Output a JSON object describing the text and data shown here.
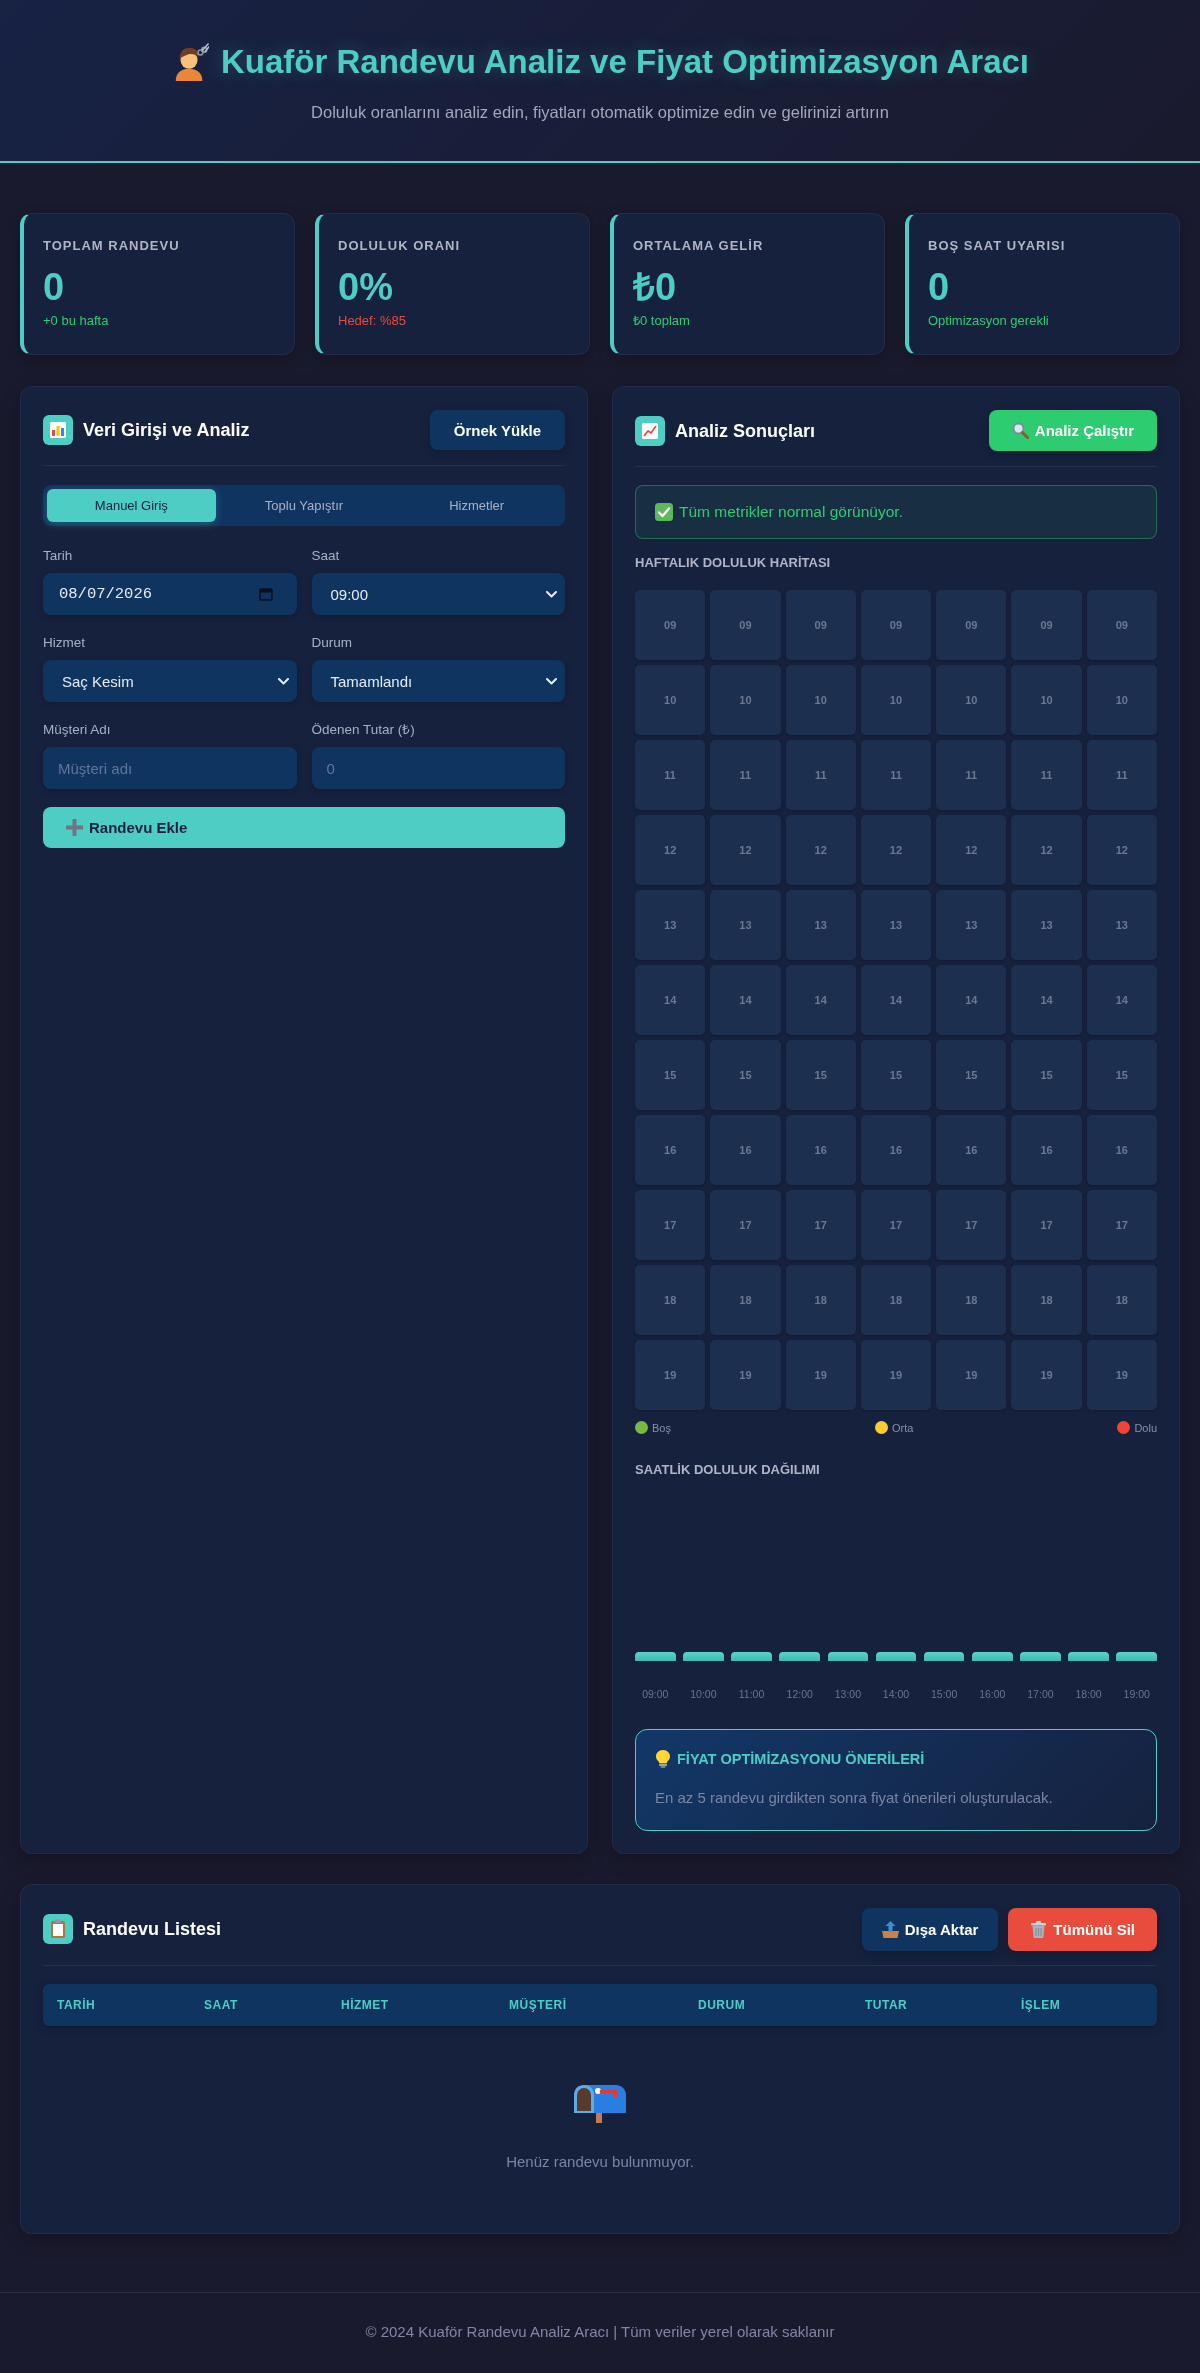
{
  "header": {
    "title": "Kuaför Randevu Analiz ve Fiyat Optimizasyon Aracı",
    "subtitle": "Doluluk oranlarını analiz edin, fiyatları otomatik optimize edin ve gelirinizi artırın"
  },
  "stats": [
    {
      "label": "TOPLAM RANDEVU",
      "value": "0",
      "note": "+0 bu hafta",
      "kind": "positive"
    },
    {
      "label": "DOLULUK ORANI",
      "value": "0%",
      "note": "Hedef: %85",
      "kind": "negative"
    },
    {
      "label": "ORTALAMA GELİR",
      "value": "₺0",
      "note": "₺0 toplam",
      "kind": "positive"
    },
    {
      "label": "BOŞ SAAT UYARISI",
      "value": "0",
      "note": "Optimizasyon gerekli",
      "kind": "positive"
    }
  ],
  "entry_panel": {
    "title": "Veri Girişi ve Analiz",
    "sample_button": "Örnek Yükle",
    "tabs": [
      {
        "label": "Manuel Giriş",
        "selected": true
      },
      {
        "label": "Toplu Yapıştır",
        "selected": false
      },
      {
        "label": "Hizmetler",
        "selected": false
      }
    ],
    "fields": [
      {
        "label": "Tarih",
        "kind": "date",
        "value": "08/07/2026"
      },
      {
        "label": "Saat",
        "kind": "select",
        "value": "09:00"
      },
      {
        "label": "Hizmet",
        "kind": "select",
        "value": "Saç Kesim"
      },
      {
        "label": "Durum",
        "kind": "select",
        "value": "Tamamlandı"
      },
      {
        "label": "Müşteri Adı",
        "kind": "text",
        "placeholder": "Müşteri adı"
      },
      {
        "label": "Ödenen Tutar (₺)",
        "kind": "number",
        "placeholder": "0"
      }
    ],
    "add_button": "Randevu Ekle"
  },
  "analysis_panel": {
    "title": "Analiz Sonuçları",
    "run_button": "Analiz Çalıştır",
    "alert": {
      "kind": "success",
      "text": "Tüm metrikler normal görünüyor."
    },
    "heatmap": {
      "title": "HAFTALIK DOLULUK HARİTASI",
      "rows": [
        [
          "09",
          "09",
          "09",
          "09",
          "09",
          "09",
          "09"
        ],
        [
          "10",
          "10",
          "10",
          "10",
          "10",
          "10",
          "10"
        ],
        [
          "11",
          "11",
          "11",
          "11",
          "11",
          "11",
          "11"
        ],
        [
          "12",
          "12",
          "12",
          "12",
          "12",
          "12",
          "12"
        ],
        [
          "13",
          "13",
          "13",
          "13",
          "13",
          "13",
          "13"
        ],
        [
          "14",
          "14",
          "14",
          "14",
          "14",
          "14",
          "14"
        ],
        [
          "15",
          "15",
          "15",
          "15",
          "15",
          "15",
          "15"
        ],
        [
          "16",
          "16",
          "16",
          "16",
          "16",
          "16",
          "16"
        ],
        [
          "17",
          "17",
          "17",
          "17",
          "17",
          "17",
          "17"
        ],
        [
          "18",
          "18",
          "18",
          "18",
          "18",
          "18",
          "18"
        ],
        [
          "19",
          "19",
          "19",
          "19",
          "19",
          "19",
          "19"
        ]
      ]
    },
    "legend": [
      {
        "label": "Boş",
        "color": "#78b943"
      },
      {
        "label": "Orta",
        "color": "#fccb2e"
      },
      {
        "label": "Dolu",
        "color": "#ef4436"
      }
    ],
    "hourly": {
      "title": "SAATLİK DOLULUK DAĞILIMI",
      "hours": [
        "09:00",
        "10:00",
        "11:00",
        "12:00",
        "13:00",
        "14:00",
        "15:00",
        "16:00",
        "17:00",
        "18:00",
        "19:00"
      ]
    },
    "pricing": {
      "title": "FİYAT OPTİMİZASYONU ÖNERİLERİ",
      "text": "En az 5 randevu girdikten sonra fiyat önerileri oluşturulacak."
    }
  },
  "list_panel": {
    "title": "Randevu Listesi",
    "export_button": "Dışa Aktar",
    "clear_button": "Tümünü Sil",
    "columns": [
      "TARİH",
      "SAAT",
      "HİZMET",
      "MÜŞTERİ",
      "DURUM",
      "TUTAR",
      "İŞLEM"
    ],
    "empty_text": "Henüz randevu bulunmuyor."
  },
  "footer": {
    "text": "© 2024 Kuaför Randevu Analiz Aracı | Tüm veriler yerel olarak saklanır"
  }
}
